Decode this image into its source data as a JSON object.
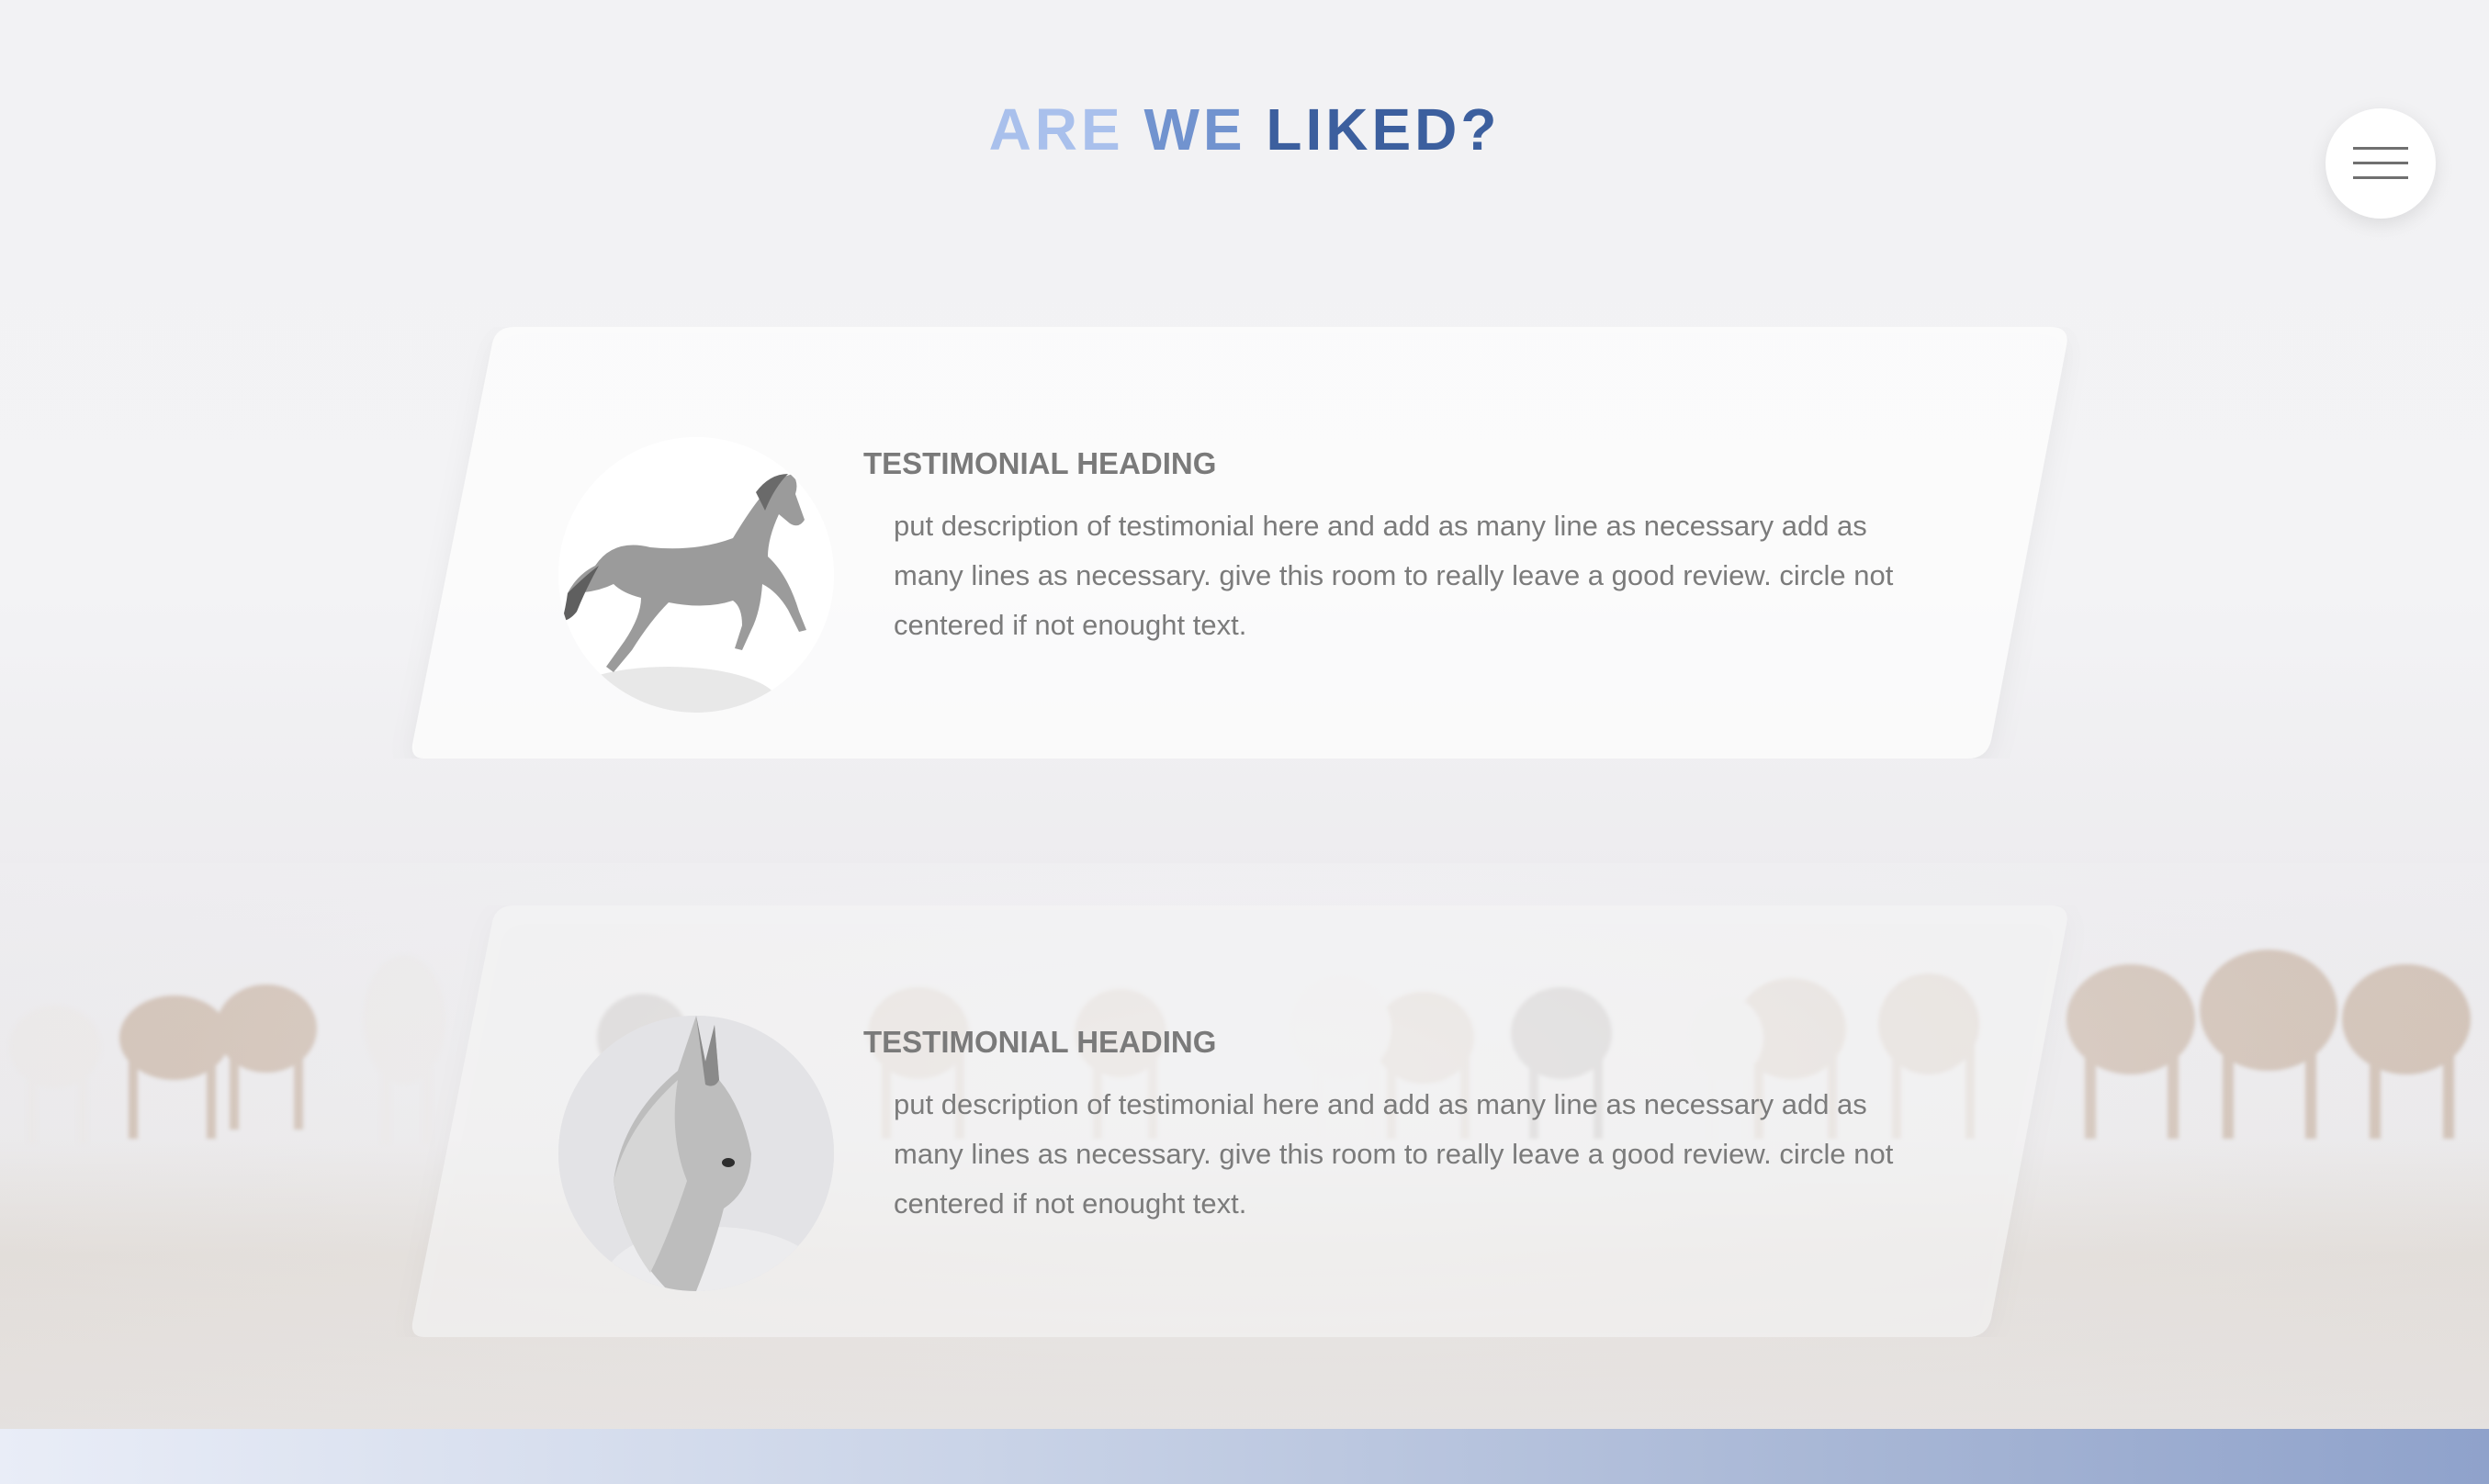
{
  "header": {
    "title_words": [
      "ARE",
      "WE",
      "LIKED?"
    ],
    "title_colors": [
      "#a9c0ec",
      "#7193cf",
      "#3c5f9e"
    ]
  },
  "menu": {
    "icon": "hamburger-menu-icon"
  },
  "testimonials": [
    {
      "heading": "TESTIMONIAL HEADING",
      "description": "put description of testimonial here and add as many line as necessary add as many lines as necessary. give this room to really leave a good review. circle not centered if not enought text.",
      "image": "rearing-white-horse"
    },
    {
      "heading": "TESTIMONIAL HEADING",
      "description": "put description of testimonial here and add as many line as necessary add as many lines as necessary. give this room to really leave a good review. circle not centered if not enought text.",
      "image": "white-horse-head"
    }
  ],
  "colors": {
    "footer_gradient_start": "#e9edf7",
    "footer_gradient_end": "#8fa2cb",
    "text_gray": "#7a7a7a"
  }
}
